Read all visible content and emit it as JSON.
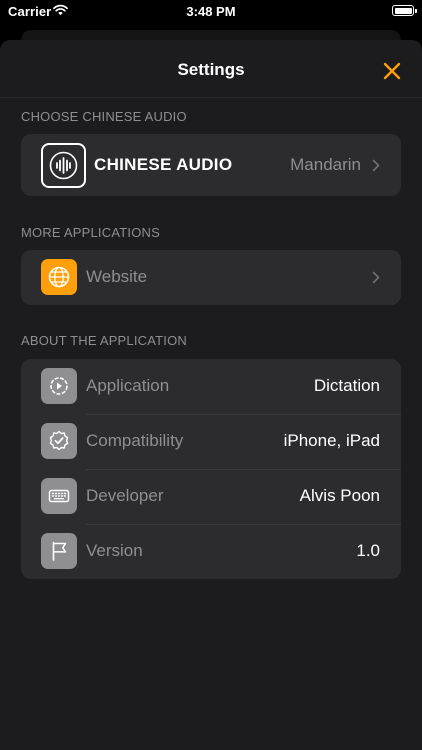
{
  "status_bar": {
    "carrier": "Carrier",
    "time": "3:48 PM",
    "wifi_icon": "wifi-icon",
    "battery_icon": "battery-icon"
  },
  "nav": {
    "title": "Settings",
    "close_icon": "close-icon",
    "accent_color": "#ff9f0a"
  },
  "sections": {
    "audio": {
      "header": "CHOOSE CHINESE AUDIO",
      "title": "CHINESE AUDIO",
      "value": "Mandarin",
      "icon": "audio-waveform-icon"
    },
    "more_apps": {
      "header": "MORE APPLICATIONS",
      "label": "Website",
      "icon": "globe-icon"
    },
    "about": {
      "header": "ABOUT THE APPLICATION",
      "rows": [
        {
          "label": "Application",
          "value": "Dictation",
          "icon": "app-settings-icon"
        },
        {
          "label": "Compatibility",
          "value": "iPhone, iPad",
          "icon": "checkmark-seal-icon"
        },
        {
          "label": "Developer",
          "value": "Alvis Poon",
          "icon": "keyboard-icon"
        },
        {
          "label": "Version",
          "value": "1.0",
          "icon": "flag-icon"
        }
      ]
    }
  }
}
